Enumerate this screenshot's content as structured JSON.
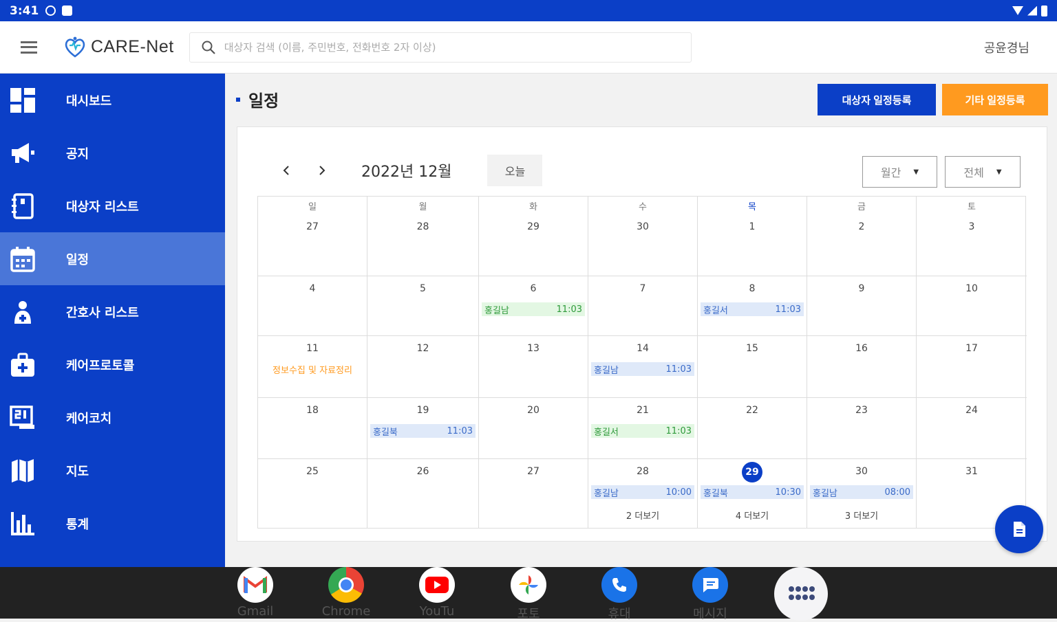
{
  "status_bar": {
    "time": "3:41"
  },
  "header": {
    "logo_text": "CARE-Net",
    "search_placeholder": "대상자 검색 (이름, 주민번호, 전화번호 2자 이상)",
    "user_name": "공윤경님"
  },
  "sidebar": {
    "items": [
      {
        "label": "대시보드",
        "icon": "dashboard-icon"
      },
      {
        "label": "공지",
        "icon": "megaphone-icon"
      },
      {
        "label": "대상자 리스트",
        "icon": "notebook-icon"
      },
      {
        "label": "일정",
        "icon": "calendar-icon",
        "active": true
      },
      {
        "label": "간호사 리스트",
        "icon": "nurse-icon"
      },
      {
        "label": "케어프로토콜",
        "icon": "medical-kit-icon"
      },
      {
        "label": "케어코치",
        "icon": "coach-icon"
      },
      {
        "label": "지도",
        "icon": "map-icon"
      },
      {
        "label": "통계",
        "icon": "bar-chart-icon"
      }
    ]
  },
  "page": {
    "title": "일정",
    "register_subject_schedule": "대상자 일정등록",
    "register_other_schedule": "기타 일정등록"
  },
  "calendar": {
    "month_title": "2022년 12월",
    "today_label": "오늘",
    "view_select": "월간",
    "filter_select": "전체",
    "weekdays": [
      "일",
      "월",
      "화",
      "수",
      "목",
      "금",
      "토"
    ],
    "weeks": [
      [
        "27",
        "28",
        "29",
        "30",
        "1",
        "2",
        "3"
      ],
      [
        "4",
        "5",
        "6",
        "7",
        "8",
        "9",
        "10"
      ],
      [
        "11",
        "12",
        "13",
        "14",
        "15",
        "16",
        "17"
      ],
      [
        "18",
        "19",
        "20",
        "21",
        "22",
        "23",
        "24"
      ],
      [
        "25",
        "26",
        "27",
        "28",
        "29",
        "30",
        "31"
      ]
    ],
    "today": "29",
    "events": {
      "dec6": {
        "name": "홍길남",
        "time": "11:03",
        "color": "#e3f7e3"
      },
      "dec8": {
        "name": "홍길서",
        "time": "11:03",
        "color": "#dfe9f9"
      },
      "dec11": {
        "name": "정보수집 및 자료정리",
        "color": "#ff9a1f"
      },
      "dec14": {
        "name": "홍길남",
        "time": "11:03"
      },
      "dec19": {
        "name": "홍길북",
        "time": "11:03"
      },
      "dec21": {
        "name": "홍길서",
        "time": "11:03"
      },
      "dec28": {
        "name": "홍길남",
        "time": "10:00",
        "more": "2 더보기"
      },
      "dec29": {
        "name": "홍길북",
        "time": "10:30",
        "more": "4 더보기"
      },
      "dec30": {
        "name": "홍길남",
        "time": "08:00",
        "more": "3 더보기"
      }
    }
  },
  "dock": {
    "apps": [
      {
        "label": "Gmail",
        "icon": "gmail-icon"
      },
      {
        "label": "Chrome",
        "icon": "chrome-icon"
      },
      {
        "label": "YouTu",
        "icon": "youtube-icon"
      },
      {
        "label": "포토",
        "icon": "photos-icon"
      },
      {
        "label": "휴대",
        "icon": "phone-icon"
      },
      {
        "label": "메시지",
        "icon": "messages-icon"
      }
    ]
  },
  "colors": {
    "primary": "#0b3fc7",
    "accent_orange": "#ff9a1f",
    "sidebar_active": "#4a76d8",
    "event_blue_bg": "#dfe9f9",
    "event_green_bg": "#e3f7e3"
  }
}
